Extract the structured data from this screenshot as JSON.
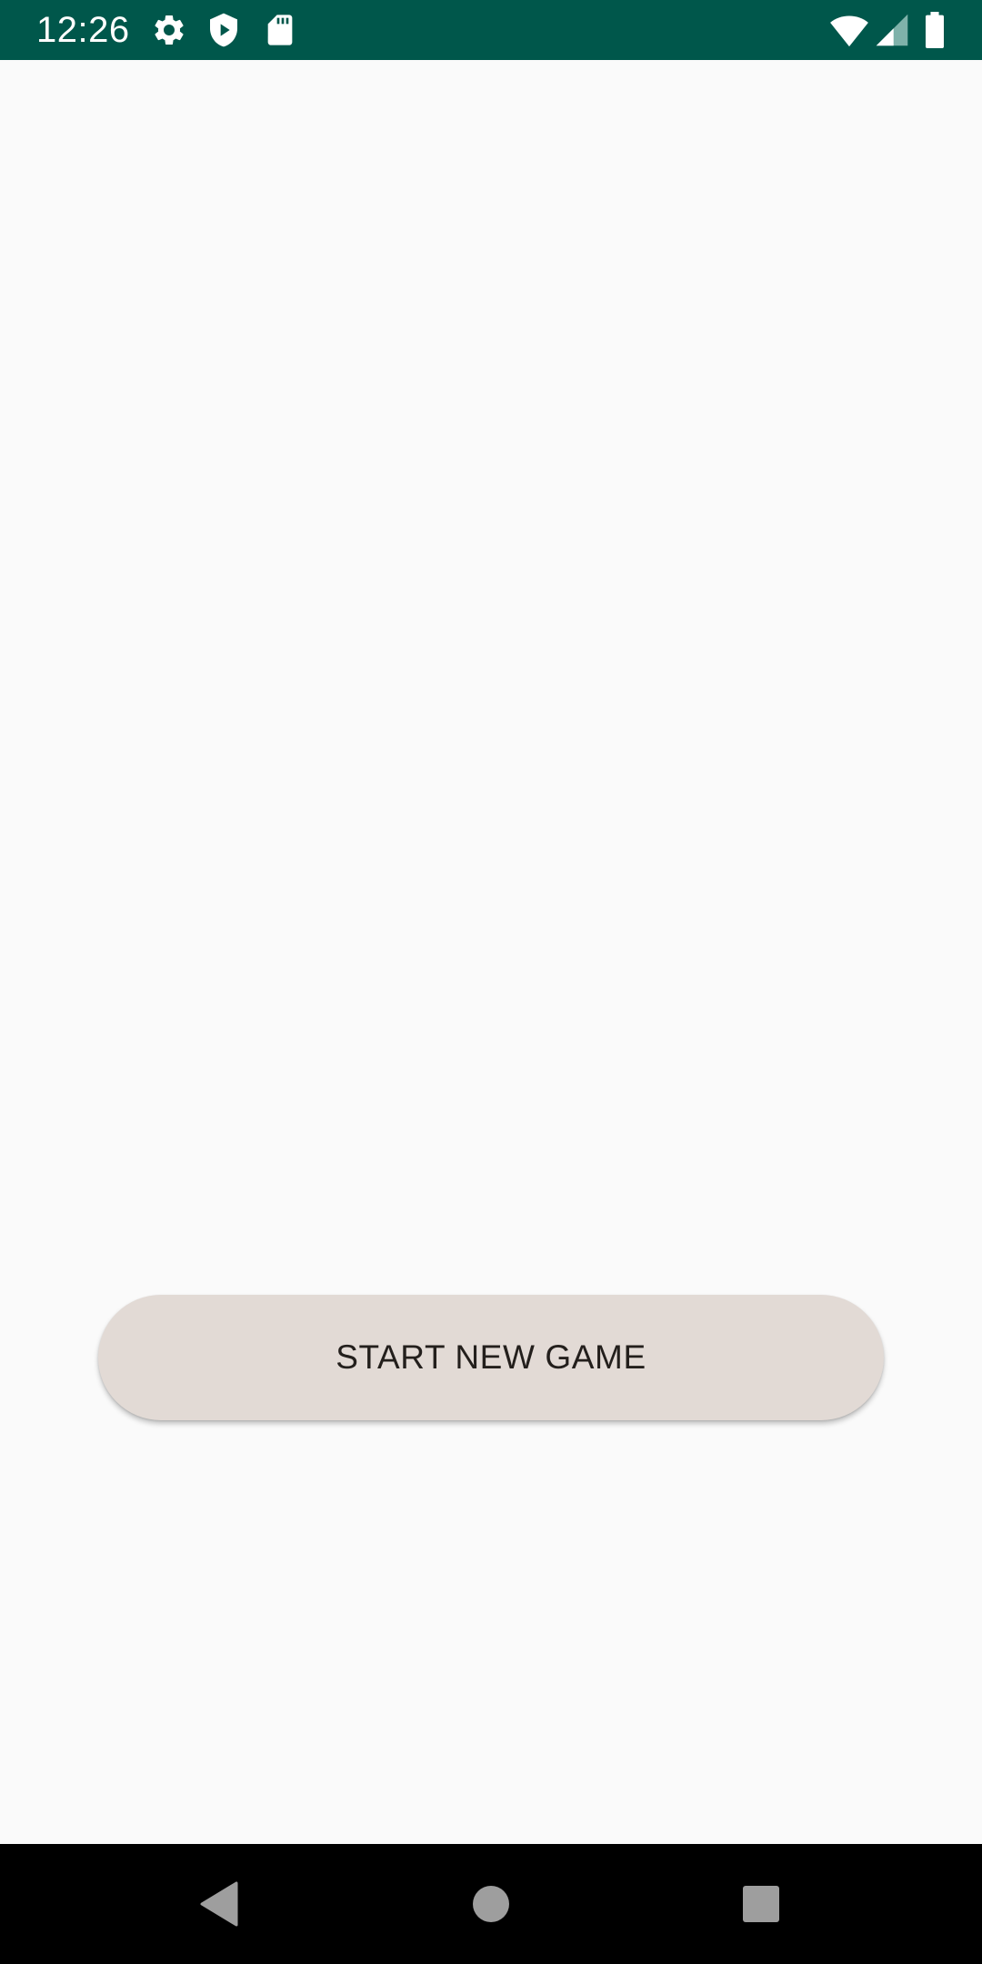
{
  "status_bar": {
    "time": "12:26",
    "background": "#00574b",
    "icons": [
      "settings-icon",
      "shield-play-icon",
      "sd-card-icon",
      "wifi-icon",
      "cellular-signal-icon",
      "battery-icon"
    ]
  },
  "main": {
    "background": "#fafafa",
    "start_button": {
      "label": "START NEW GAME",
      "background": "#e2dad5",
      "text_color": "#231f1c"
    }
  },
  "nav_bar": {
    "background": "#000000",
    "icons": [
      "back-icon",
      "home-icon",
      "recents-icon"
    ],
    "icon_color": "#9e9e9e"
  }
}
